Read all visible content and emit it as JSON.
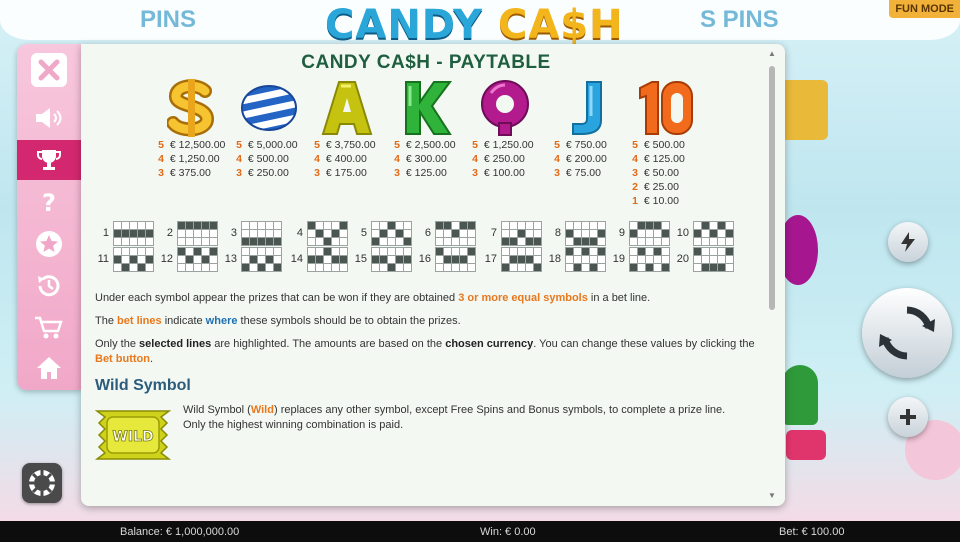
{
  "game": {
    "bg_logo_left": "CANDY",
    "bg_logo_right": "CA$H",
    "bg_side_left": "PINS",
    "bg_side_right": "S PINS",
    "fun_mode": "FUN MODE"
  },
  "sidebar": {
    "items": [
      {
        "name": "close",
        "icon": "close-icon"
      },
      {
        "name": "sound",
        "icon": "speaker-icon"
      },
      {
        "name": "paytable",
        "icon": "trophy-icon",
        "active": true
      },
      {
        "name": "help",
        "icon": "question-icon"
      },
      {
        "name": "favorites",
        "icon": "star-icon"
      },
      {
        "name": "history",
        "icon": "history-icon"
      },
      {
        "name": "shop",
        "icon": "cart-icon"
      },
      {
        "name": "home",
        "icon": "home-icon"
      }
    ]
  },
  "paytable": {
    "title": "CANDY CA$H - PAYTABLE",
    "symbols": [
      {
        "icon": "dollar-symbol-icon",
        "pays": [
          {
            "n": "5",
            "v": "€ 12,500.00"
          },
          {
            "n": "4",
            "v": "€ 1,250.00"
          },
          {
            "n": "3",
            "v": "€ 375.00"
          }
        ]
      },
      {
        "icon": "striped-candy-icon",
        "pays": [
          {
            "n": "5",
            "v": "€ 5,000.00"
          },
          {
            "n": "4",
            "v": "€ 500.00"
          },
          {
            "n": "3",
            "v": "€ 250.00"
          }
        ]
      },
      {
        "icon": "letter-a-icon",
        "pays": [
          {
            "n": "5",
            "v": "€ 3,750.00"
          },
          {
            "n": "4",
            "v": "€ 400.00"
          },
          {
            "n": "3",
            "v": "€ 175.00"
          }
        ]
      },
      {
        "icon": "letter-k-icon",
        "pays": [
          {
            "n": "5",
            "v": "€ 2,500.00"
          },
          {
            "n": "4",
            "v": "€ 300.00"
          },
          {
            "n": "3",
            "v": "€ 125.00"
          }
        ]
      },
      {
        "icon": "letter-q-icon",
        "pays": [
          {
            "n": "5",
            "v": "€ 1,250.00"
          },
          {
            "n": "4",
            "v": "€ 250.00"
          },
          {
            "n": "3",
            "v": "€ 100.00"
          }
        ]
      },
      {
        "icon": "letter-j-icon",
        "pays": [
          {
            "n": "5",
            "v": "€ 750.00"
          },
          {
            "n": "4",
            "v": "€ 200.00"
          },
          {
            "n": "3",
            "v": "€ 75.00"
          }
        ]
      },
      {
        "icon": "number-10-icon",
        "pays": [
          {
            "n": "5",
            "v": "€ 500.00"
          },
          {
            "n": "4",
            "v": "€ 125.00"
          },
          {
            "n": "3",
            "v": "€ 50.00"
          },
          {
            "n": "2",
            "v": "€ 25.00"
          },
          {
            "n": "1",
            "v": "€ 10.00"
          }
        ]
      }
    ],
    "lines": [
      {
        "n": "1",
        "p": [
          1,
          1,
          1,
          1,
          1
        ]
      },
      {
        "n": "2",
        "p": [
          0,
          0,
          0,
          0,
          0
        ]
      },
      {
        "n": "3",
        "p": [
          2,
          2,
          2,
          2,
          2
        ]
      },
      {
        "n": "4",
        "p": [
          0,
          1,
          2,
          1,
          0
        ]
      },
      {
        "n": "5",
        "p": [
          2,
          1,
          0,
          1,
          2
        ]
      },
      {
        "n": "6",
        "p": [
          0,
          0,
          1,
          0,
          0
        ]
      },
      {
        "n": "7",
        "p": [
          2,
          2,
          1,
          2,
          2
        ]
      },
      {
        "n": "8",
        "p": [
          1,
          2,
          2,
          2,
          1
        ]
      },
      {
        "n": "9",
        "p": [
          1,
          0,
          0,
          0,
          1
        ]
      },
      {
        "n": "10",
        "p": [
          1,
          0,
          1,
          0,
          1
        ]
      },
      {
        "n": "11",
        "p": [
          1,
          2,
          1,
          2,
          1
        ]
      },
      {
        "n": "12",
        "p": [
          0,
          1,
          0,
          1,
          0
        ]
      },
      {
        "n": "13",
        "p": [
          2,
          1,
          2,
          1,
          2
        ]
      },
      {
        "n": "14",
        "p": [
          1,
          1,
          0,
          1,
          1
        ]
      },
      {
        "n": "15",
        "p": [
          1,
          1,
          2,
          1,
          1
        ]
      },
      {
        "n": "16",
        "p": [
          0,
          1,
          1,
          1,
          0
        ]
      },
      {
        "n": "17",
        "p": [
          2,
          1,
          1,
          1,
          2
        ]
      },
      {
        "n": "18",
        "p": [
          0,
          2,
          0,
          2,
          0
        ]
      },
      {
        "n": "19",
        "p": [
          2,
          0,
          2,
          0,
          2
        ]
      },
      {
        "n": "20",
        "p": [
          0,
          2,
          2,
          2,
          0
        ]
      }
    ],
    "para1": {
      "a": "Under each symbol appear the prizes that can be won if they are obtained ",
      "b": "3 or more equal symbols",
      "c": " in a bet line."
    },
    "para2": {
      "a": "The ",
      "b": "bet lines",
      "c": " indicate ",
      "d": "where",
      "e": " these symbols should be to obtain the prizes."
    },
    "para3": {
      "a": "Only the ",
      "b": "selected lines",
      "c": " are highlighted. The amounts are based on the ",
      "d": "chosen currency",
      "e": ". You can change these values by clicking the ",
      "f": "Bet button",
      "g": "."
    },
    "wild_title": "Wild Symbol",
    "wild_badge": "WILD",
    "wild_text": {
      "a": "Wild Symbol (",
      "b": "Wild",
      "c": ") replaces any other symbol, except Free Spins and Bonus symbols, to complete a prize line.",
      "d": "Only the highest winning combination is paid."
    }
  },
  "status_bar": {
    "balance": "Balance: € 1,000,000.00",
    "win": "Win: € 0.00",
    "bet": "Bet: € 100.00"
  }
}
